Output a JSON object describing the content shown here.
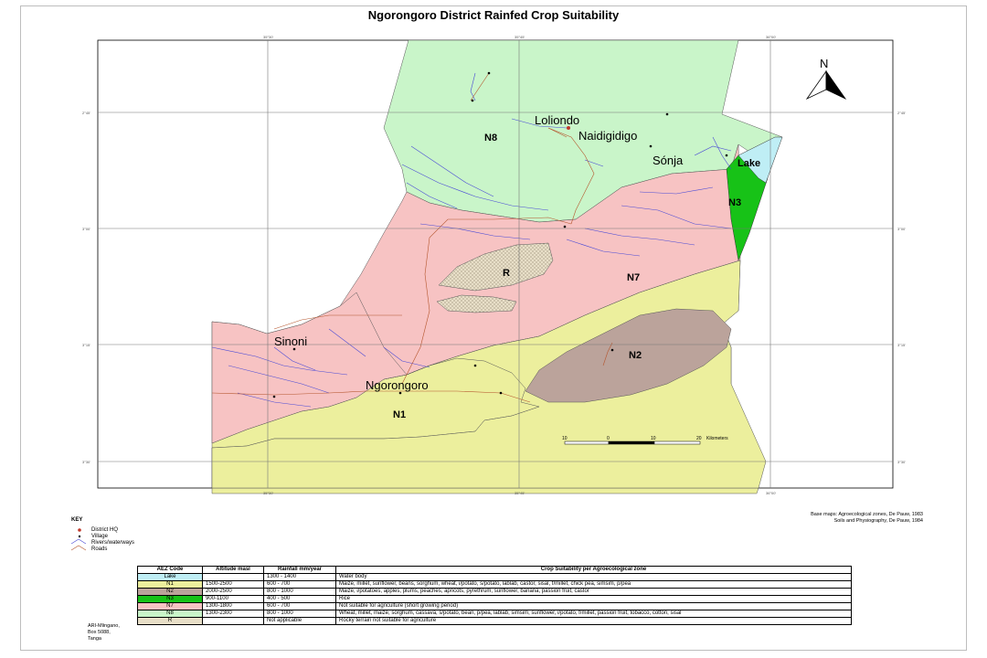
{
  "title": "Ngorongoro District Rainfed Crop Suitability",
  "graticule": {
    "top": [
      "35°30'",
      "35°45'",
      "36°00'"
    ],
    "bottom": [
      "35°30'",
      "35°45'",
      "36°00'"
    ],
    "left": [
      "2°45'",
      "3°00'",
      "3°15'",
      "3°30'"
    ],
    "right": [
      "2°45'",
      "3°00'",
      "3°15'",
      "3°30'"
    ]
  },
  "zones": {
    "n8": "N8",
    "n7": "N7",
    "n3": "N3",
    "n2": "N2",
    "n1": "N1",
    "r": "R",
    "lake": "Lake"
  },
  "places": {
    "loliondo": "Loliondo",
    "naidigidigo": "Naidigidigo",
    "sonja": "Sónja",
    "sinoni": "Sinoni",
    "ngorongoro": "Ngorongoro"
  },
  "north_label": "N",
  "scale_bar": {
    "labels": [
      "10",
      "0",
      "10",
      "20"
    ],
    "unit": "Kilometers"
  },
  "key": {
    "title": "KEY",
    "items": [
      {
        "label": "District HQ",
        "icon": "district-hq-dot"
      },
      {
        "label": "Village",
        "icon": "village-dot"
      },
      {
        "label": "Rivers/waterways",
        "icon": "river-line"
      },
      {
        "label": "Roads",
        "icon": "road-line"
      }
    ]
  },
  "credits": [
    "Base maps: Agroecological zones, De Pauw, 1983",
    "Soils and Physiography, De Pauw, 1984"
  ],
  "table": {
    "headers": [
      "AEZ Code",
      "Altitude masl",
      "Rainfall mm/year",
      "Crop Suitability per Agroecological zone"
    ],
    "rows": [
      {
        "code": "Lake",
        "alt": "",
        "rain": "1300 - 1400",
        "crops": "Water body",
        "color": "#bfeef5"
      },
      {
        "code": "N1",
        "alt": "1500-2500",
        "rain": "600 - 700",
        "crops": "Maize, millet, sunflower, beans, sorghum, wheat, i/potato, s/potato, lablab, castor, sisal, f/millet, chick pea, simsim, p/pea",
        "color": "#ecef9d"
      },
      {
        "code": "N2",
        "alt": "2000-2500",
        "rain": "800 - 1000",
        "crops": "Maize, i/potatoes, apples, plums, peaches, apricots, pyrethrum, sunflower, banana, passion fruit, castor",
        "color": "#bba39b"
      },
      {
        "code": "N3",
        "alt": "900-1100",
        "rain": "400 - 500",
        "crops": "Rice",
        "color": "#17c217"
      },
      {
        "code": "N7",
        "alt": "1300-1800",
        "rain": "600 - 700",
        "crops": "Not suitable for agriculture (short growing period)",
        "color": "#f7c3c3"
      },
      {
        "code": "N8",
        "alt": "1300-2300",
        "rain": "800 - 1000",
        "crops": "Wheat, millet, maize, sorghum, cassava, s/potato, bean, p/pea, lablab, simsim, sunflower, i/potato, f/millet, passion fruit, tobacco, cotton, sisal",
        "color": "#c9f5c9"
      },
      {
        "code": "R",
        "alt": "",
        "rain": "Not applicable",
        "crops": "Rocky terrain not suitable for agriculture",
        "color": "#e8dfc8"
      }
    ]
  },
  "address": [
    "ARI-Mlingano,",
    "Box 5088,",
    "Tanga"
  ],
  "colors": {
    "n8": "#c9f5c9",
    "n7": "#f7c3c3",
    "n1": "#ecef9d",
    "n2": "#bba39b",
    "n3": "#17c217",
    "lake": "#bfeef5",
    "rivers": "#4b4bd6",
    "roads": "#b5562e"
  }
}
